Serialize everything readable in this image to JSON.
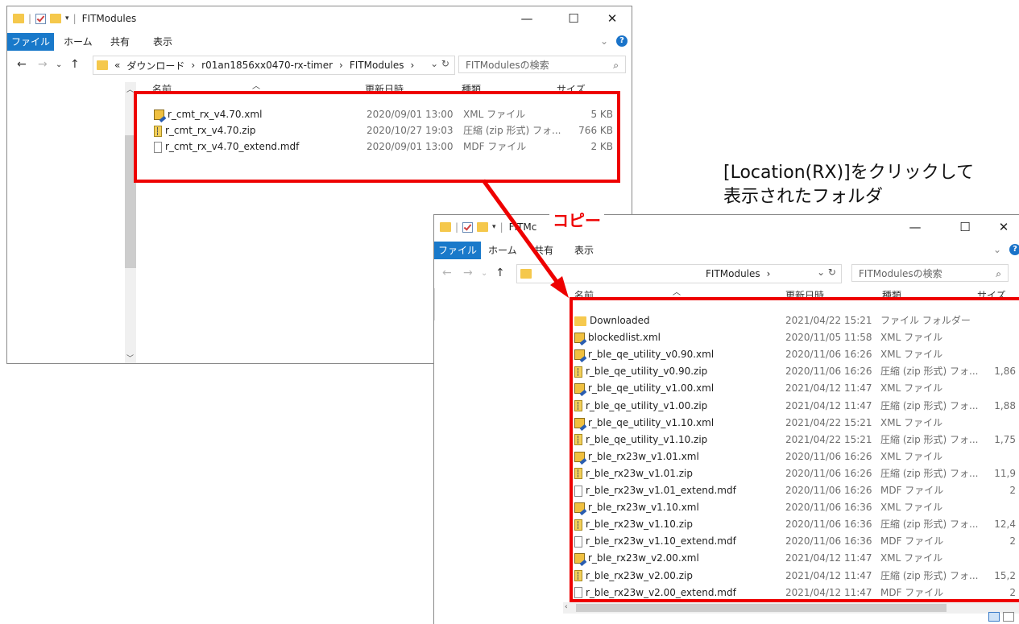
{
  "window1": {
    "title": "FITModules",
    "ribbon_tabs": [
      "ファイル",
      "ホーム",
      "共有",
      "表示"
    ],
    "breadcrumb": [
      "«",
      "ダウンロード",
      "r01an1856xx0470-rx-timer",
      "FITModules"
    ],
    "search_placeholder": "FITModulesの検索",
    "columns": {
      "name": "名前",
      "date": "更新日時",
      "type": "種類",
      "size": "サイズ"
    },
    "files": [
      {
        "icon": "xml-file-icon",
        "name": "r_cmt_rx_v4.70.xml",
        "date": "2020/09/01 13:00",
        "type": "XML ファイル",
        "size": "5 KB"
      },
      {
        "icon": "zip-file-icon",
        "name": "r_cmt_rx_v4.70.zip",
        "date": "2020/10/27 19:03",
        "type": "圧縮 (zip 形式) フォ...",
        "size": "766 KB"
      },
      {
        "icon": "file-icon",
        "name": "r_cmt_rx_v4.70_extend.mdf",
        "date": "2020/09/01 13:00",
        "type": "MDF ファイル",
        "size": "2 KB"
      }
    ]
  },
  "window2": {
    "title": "FITMc",
    "ribbon_tabs": [
      "ファイル",
      "ホーム",
      "共有",
      "表示"
    ],
    "breadcrumb": [
      "FITModules"
    ],
    "search_placeholder": "FITModulesの検索",
    "columns": {
      "name": "名前",
      "date": "更新日時",
      "type": "種類",
      "size": "サイズ"
    },
    "files": [
      {
        "icon": "folder-icon",
        "name": "Downloaded",
        "date": "2021/04/22 15:21",
        "type": "ファイル フォルダー",
        "size": ""
      },
      {
        "icon": "xml-file-icon",
        "name": "blockedlist.xml",
        "date": "2020/11/05 11:58",
        "type": "XML ファイル",
        "size": ""
      },
      {
        "icon": "xml-file-icon",
        "name": "r_ble_qe_utility_v0.90.xml",
        "date": "2020/11/06 16:26",
        "type": "XML ファイル",
        "size": ""
      },
      {
        "icon": "zip-file-icon",
        "name": "r_ble_qe_utility_v0.90.zip",
        "date": "2020/11/06 16:26",
        "type": "圧縮 (zip 形式) フォ...",
        "size": "1,86"
      },
      {
        "icon": "xml-file-icon",
        "name": "r_ble_qe_utility_v1.00.xml",
        "date": "2021/04/12 11:47",
        "type": "XML ファイル",
        "size": ""
      },
      {
        "icon": "zip-file-icon",
        "name": "r_ble_qe_utility_v1.00.zip",
        "date": "2021/04/12 11:47",
        "type": "圧縮 (zip 形式) フォ...",
        "size": "1,88"
      },
      {
        "icon": "xml-file-icon",
        "name": "r_ble_qe_utility_v1.10.xml",
        "date": "2021/04/22 15:21",
        "type": "XML ファイル",
        "size": ""
      },
      {
        "icon": "zip-file-icon",
        "name": "r_ble_qe_utility_v1.10.zip",
        "date": "2021/04/22 15:21",
        "type": "圧縮 (zip 形式) フォ...",
        "size": "1,75"
      },
      {
        "icon": "xml-file-icon",
        "name": "r_ble_rx23w_v1.01.xml",
        "date": "2020/11/06 16:26",
        "type": "XML ファイル",
        "size": ""
      },
      {
        "icon": "zip-file-icon",
        "name": "r_ble_rx23w_v1.01.zip",
        "date": "2020/11/06 16:26",
        "type": "圧縮 (zip 形式) フォ...",
        "size": "11,9"
      },
      {
        "icon": "file-icon",
        "name": "r_ble_rx23w_v1.01_extend.mdf",
        "date": "2020/11/06 16:26",
        "type": "MDF ファイル",
        "size": "2"
      },
      {
        "icon": "xml-file-icon",
        "name": "r_ble_rx23w_v1.10.xml",
        "date": "2020/11/06 16:36",
        "type": "XML ファイル",
        "size": ""
      },
      {
        "icon": "zip-file-icon",
        "name": "r_ble_rx23w_v1.10.zip",
        "date": "2020/11/06 16:36",
        "type": "圧縮 (zip 形式) フォ...",
        "size": "12,4"
      },
      {
        "icon": "file-icon",
        "name": "r_ble_rx23w_v1.10_extend.mdf",
        "date": "2020/11/06 16:36",
        "type": "MDF ファイル",
        "size": "2"
      },
      {
        "icon": "xml-file-icon",
        "name": "r_ble_rx23w_v2.00.xml",
        "date": "2021/04/12 11:47",
        "type": "XML ファイル",
        "size": ""
      },
      {
        "icon": "zip-file-icon",
        "name": "r_ble_rx23w_v2.00.zip",
        "date": "2021/04/12 11:47",
        "type": "圧縮 (zip 形式) フォ...",
        "size": "15,2"
      },
      {
        "icon": "file-icon",
        "name": "r_ble_rx23w_v2.00_extend.mdf",
        "date": "2021/04/12 11:47",
        "type": "MDF ファイル",
        "size": "2"
      }
    ]
  },
  "annotation": {
    "line1": "[Location(RX)]をクリックして",
    "line2": "表示されたフォルダ",
    "copy_label": "コピー"
  },
  "colors": {
    "accent": "#1979ca",
    "highlight": "#ee0000",
    "folder": "#f6c94e"
  }
}
